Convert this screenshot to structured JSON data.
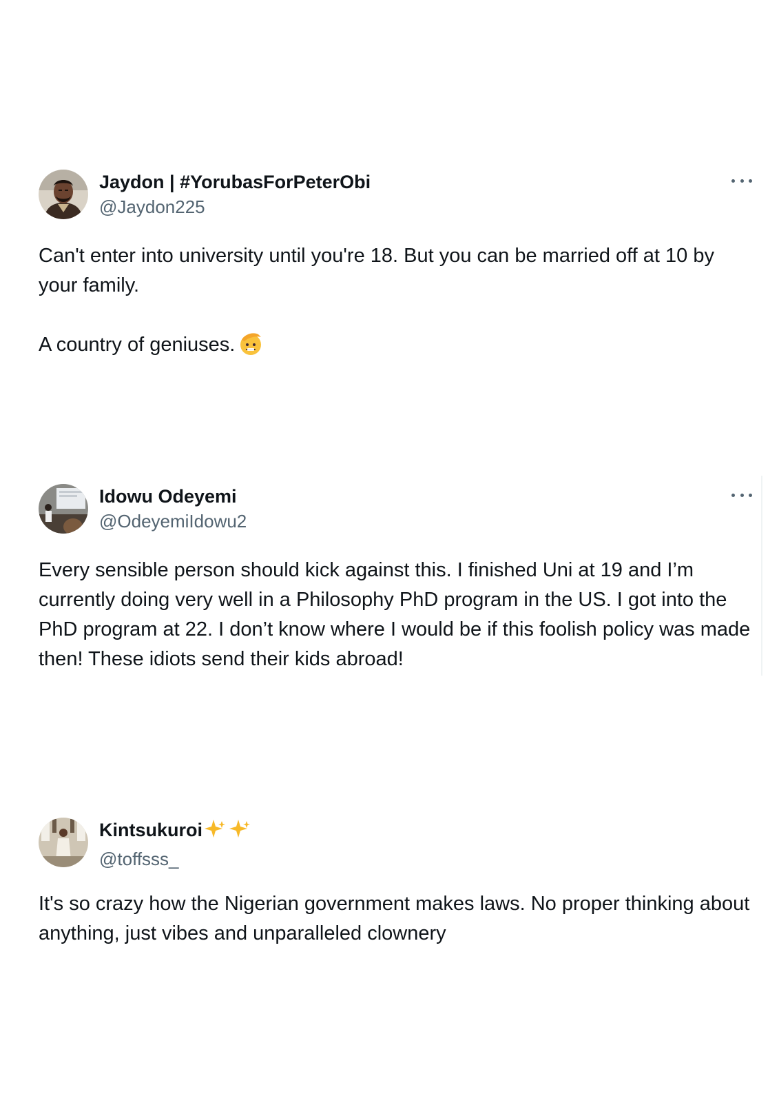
{
  "tweets": [
    {
      "display_name": "Jaydon | #YorubasForPeterObi",
      "handle": "@Jaydon225",
      "text": "Can't enter into university until you're 18. But you can be married off at 10 by your family.\n\nA country of geniuses.",
      "emoji": "saluting-face",
      "avatar": "avatar-man-portrait"
    },
    {
      "display_name": "Idowu Odeyemi",
      "handle": "@OdeyemiIdowu2",
      "text": "Every sensible person should kick against this. I finished Uni at 19 and I’m currently doing very well in a Philosophy PhD program in the US. I got into the PhD program at 22. I don’t know where I would be if this foolish policy was made then! These idiots send their kids abroad!",
      "avatar": "avatar-presentation-photo"
    },
    {
      "display_name": "Kintsukuroi",
      "display_name_emoji": "sparkles",
      "handle": "@toffsss_",
      "text": "It's so crazy how the Nigerian government makes laws. No proper thinking about anything, just vibes and unparalleled clownery",
      "avatar": "avatar-woman-photo"
    }
  ],
  "colors": {
    "text": "#0f1419",
    "secondary": "#536471",
    "emoji_yellow": "#f9c23c",
    "sparkle_gold": "#f7b928"
  }
}
